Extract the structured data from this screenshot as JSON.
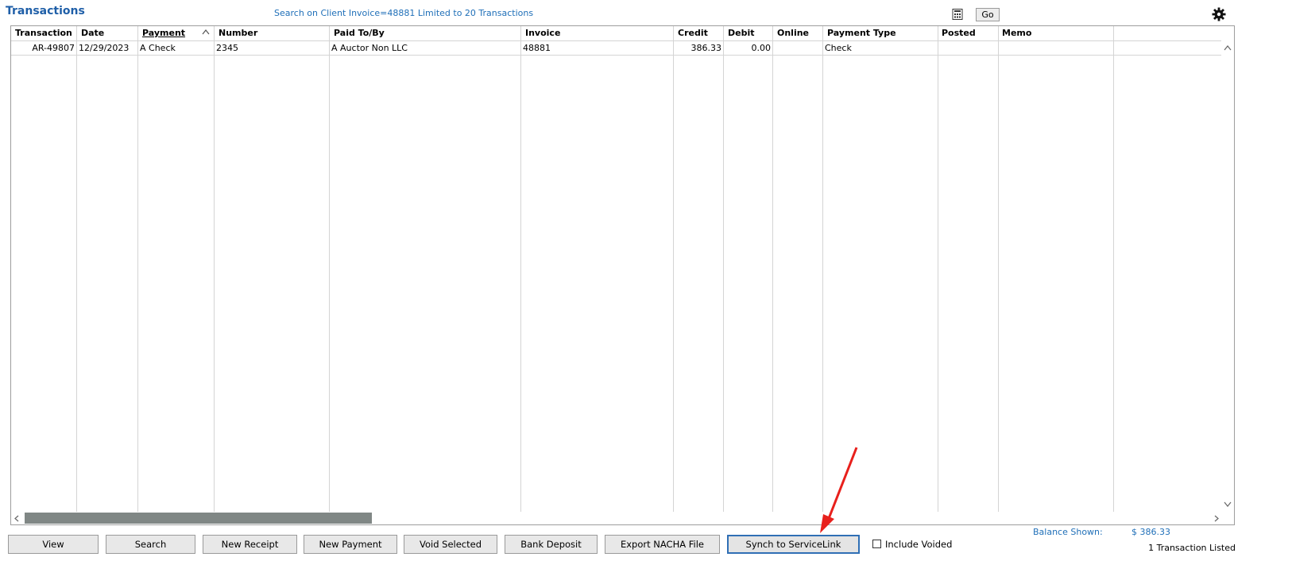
{
  "header": {
    "title": "Transactions",
    "search_info": "Search on Client Invoice=48881 Limited to 20 Transactions",
    "go_label": "Go"
  },
  "table": {
    "columns": [
      "Transaction",
      "Date",
      "Payment",
      "Number",
      "Paid To/By",
      "Invoice",
      "Credit",
      "Debit",
      "Online",
      "Payment Type",
      "Posted",
      "Memo"
    ],
    "sorted_column": "Payment",
    "rows": [
      {
        "transaction": "AR-49807",
        "date": "12/29/2023",
        "payment": "A Check",
        "number": "2345",
        "paid_to_by": "A Auctor Non LLC",
        "invoice": "48881",
        "credit": "386.33",
        "debit": "0.00",
        "online": "",
        "payment_type": "Check",
        "posted": "",
        "memo": ""
      }
    ]
  },
  "buttons": {
    "view": "View",
    "search": "Search",
    "new_receipt": "New Receipt",
    "new_payment": "New Payment",
    "void_selected": "Void Selected",
    "bank_deposit": "Bank Deposit",
    "export_nacha": "Export NACHA File",
    "synch": "Synch to ServiceLink"
  },
  "include_voided": {
    "label": "Include Voided",
    "checked": false
  },
  "footer": {
    "balance_label": "Balance Shown:",
    "balance_value": "$ 386.33",
    "count": "1 Transaction Listed"
  },
  "icons": [
    "calculator-icon",
    "gear-icon",
    "sort-ascending-icon",
    "red-arrow-annotation"
  ],
  "colors": {
    "accent": "#1f6fb8",
    "annotation": "#e8201c"
  }
}
